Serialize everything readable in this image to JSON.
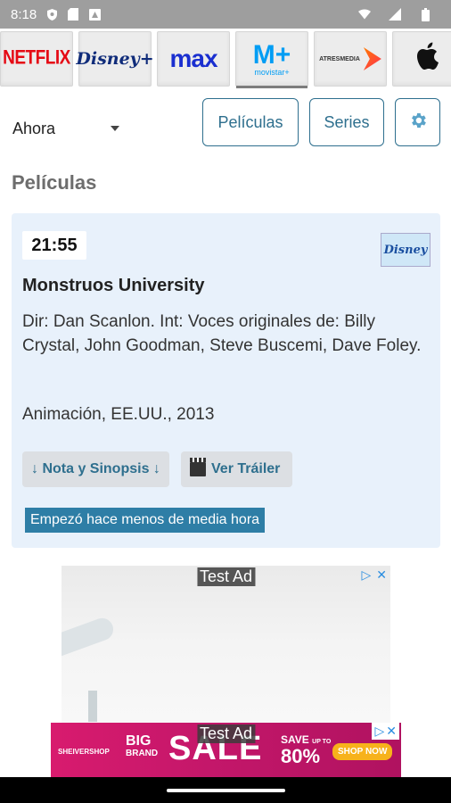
{
  "statusbar": {
    "time": "8:18"
  },
  "channels": [
    {
      "name": "NETFLIX",
      "icon": "netflix-logo"
    },
    {
      "name": "Disney+",
      "icon": "disney-plus-logo"
    },
    {
      "name": "max",
      "icon": "max-logo"
    },
    {
      "name": "M+",
      "sub": "movistar+",
      "icon": "movistar-logo"
    },
    {
      "name": "ATRESMEDIA",
      "icon": "atresmedia-logo"
    },
    {
      "name": "",
      "icon": "apple-logo"
    }
  ],
  "controls": {
    "time_select": "Ahora",
    "peliculas_label": "Películas",
    "series_label": "Series",
    "settings_icon": "gear-icon"
  },
  "section": {
    "title": "Películas"
  },
  "card": {
    "time": "21:55",
    "channel_logo": "Disney",
    "title": "Monstruos University",
    "description": "Dir: Dan Scanlon. Int: Voces originales de: Billy Crystal, John Goodman, Steve Buscemi, Dave Foley.",
    "meta": "Animación, EE.UU., 2013",
    "nota_label": "↓ Nota y Sinopsis ↓",
    "trailer_label": "Ver Tráiler",
    "status": "Empezó hace menos de media hora"
  },
  "ads": {
    "ad1_tag": "Test Ad",
    "ad2_tag": "Test Ad",
    "ad2_brand": "SHEIVERSHOP",
    "ad2_big": "BIG",
    "ad2_big_sub": "BRAND",
    "ad2_sale": "SALE",
    "ad2_save": "SAVE",
    "ad2_upto": "UP TO",
    "ad2_pct": "80%",
    "ad2_cta": "SHOP NOW"
  },
  "colors": {
    "accent": "#2e6f8e",
    "card_bg": "#e8f1fb",
    "status_tag": "#2e7ea6",
    "statusbar": "#9e9e9e"
  }
}
